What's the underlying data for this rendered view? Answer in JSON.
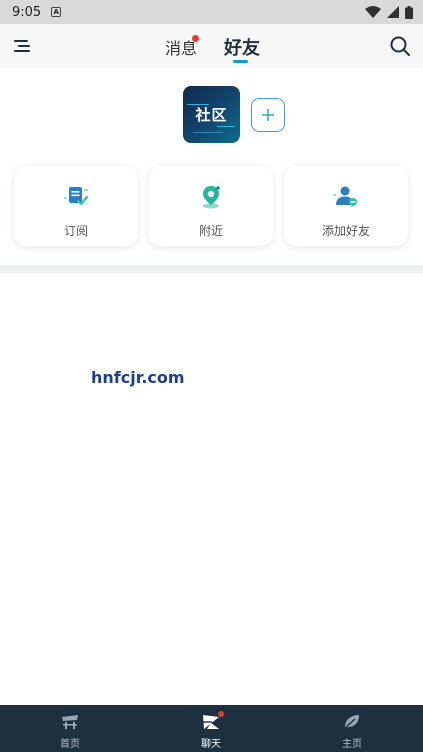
{
  "status_bar": {
    "time": "9:05",
    "notification_glyph": "A"
  },
  "header": {
    "tabs": [
      {
        "label": "消息",
        "has_badge": true
      },
      {
        "label": "好友",
        "active": true
      }
    ],
    "accent_color": "#1a9bd7"
  },
  "community": {
    "logo_text": "社区"
  },
  "quick_actions": [
    {
      "label": "订阅",
      "icon": "subscribe-icon"
    },
    {
      "label": "附近",
      "icon": "location-pin-icon"
    },
    {
      "label": "添加好友",
      "icon": "add-friend-icon"
    }
  ],
  "watermark": "hnfcjr.com",
  "bottom_nav": [
    {
      "label": "首页",
      "icon": "home-icon"
    },
    {
      "label": "聊天",
      "icon": "chat-icon",
      "active": true,
      "has_badge": true
    },
    {
      "label": "主页",
      "icon": "profile-icon"
    }
  ],
  "colors": {
    "nav_background": "#1e2f40",
    "badge": "#e53935"
  }
}
